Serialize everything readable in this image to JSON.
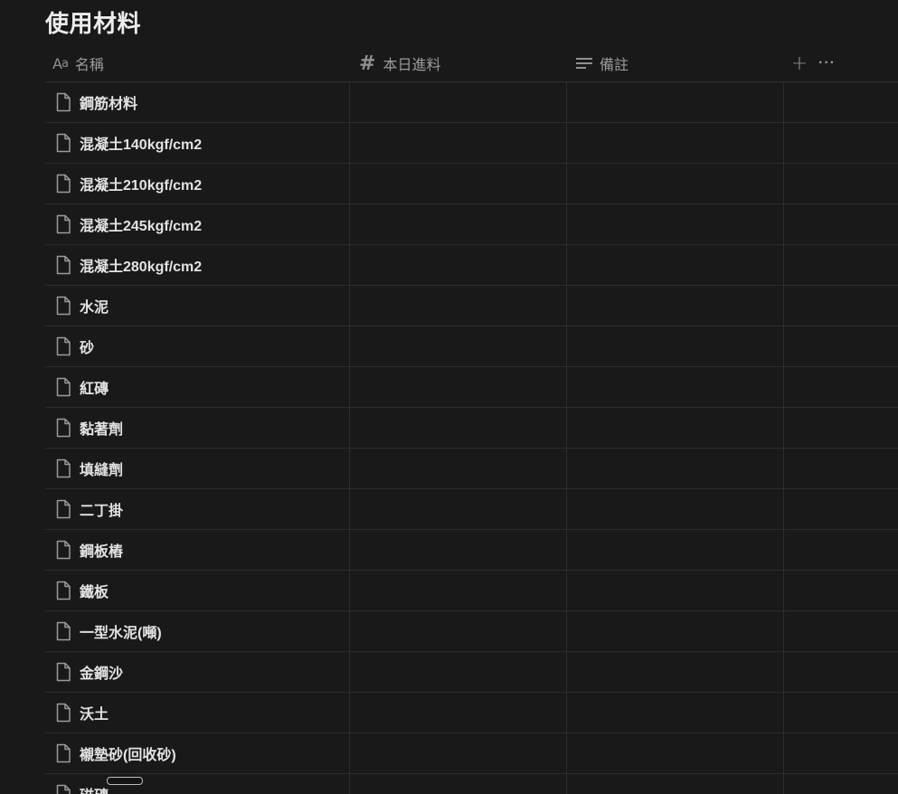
{
  "page_title": "使用材料",
  "columns": {
    "name": {
      "label": "名稱",
      "icon": "text-type-icon"
    },
    "qty": {
      "label": "本日進料",
      "icon": "number-icon"
    },
    "note": {
      "label": "備註",
      "icon": "text-lines-icon"
    }
  },
  "header_actions": {
    "add_icon": "+",
    "more_icon": "···"
  },
  "rows": [
    {
      "name": "鋼筋材料"
    },
    {
      "name": "混凝土140kgf/cm2"
    },
    {
      "name": "混凝土210kgf/cm2"
    },
    {
      "name": "混凝土245kgf/cm2"
    },
    {
      "name": "混凝土280kgf/cm2"
    },
    {
      "name": "水泥"
    },
    {
      "name": "砂"
    },
    {
      "name": "紅磚"
    },
    {
      "name": "黏著劑"
    },
    {
      "name": "填縫劑"
    },
    {
      "name": "二丁掛"
    },
    {
      "name": "鋼板樁"
    },
    {
      "name": "鐵板"
    },
    {
      "name": "一型水泥(噸)"
    },
    {
      "name": "金鋼沙"
    },
    {
      "name": "沃土"
    },
    {
      "name": "襯墊砂(回收砂)"
    },
    {
      "name": "磁磚"
    }
  ]
}
